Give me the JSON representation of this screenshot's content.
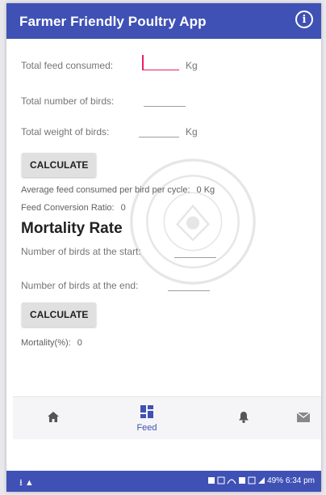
{
  "app_bar": {
    "title": "Farmer Friendly Poultry App",
    "icon": "info-icon"
  },
  "feed_form": {
    "total_feed_label": "Total feed consumed:",
    "total_feed_value": "",
    "total_feed_unit": "Kg",
    "total_birds_label": "Total number of birds:",
    "total_birds_value": "",
    "total_weight_label": "Total weight of birds:",
    "total_weight_value": "",
    "total_weight_unit": "Kg",
    "calculate_label": "CALCULATE",
    "avg_feed_label": "Average feed consumed per bird per cycle:",
    "avg_feed_value": "0 Kg",
    "fcr_label": "Feed Conversion Ratio:",
    "fcr_value": "0"
  },
  "mortality": {
    "title": "Mortality Rate",
    "start_label": "Number of birds at the start:",
    "start_value": "",
    "end_label": "Number of birds at the end:",
    "end_value": "",
    "calculate_label": "CALCULATE",
    "result_label": "Mortality(%):",
    "result_value": "0"
  },
  "bottom_nav": {
    "items": [
      {
        "icon": "home-icon",
        "label": ""
      },
      {
        "icon": "dashboard-icon",
        "label": "Feed",
        "selected": true
      },
      {
        "icon": "bell-icon",
        "label": ""
      },
      {
        "icon": "mail-icon",
        "label": ""
      }
    ]
  },
  "status_bar": {
    "left": "⭳ ▲",
    "right": "49% 6:34 pm"
  },
  "colors": {
    "primary": "#3f51b5",
    "accent": "#e91e63"
  }
}
